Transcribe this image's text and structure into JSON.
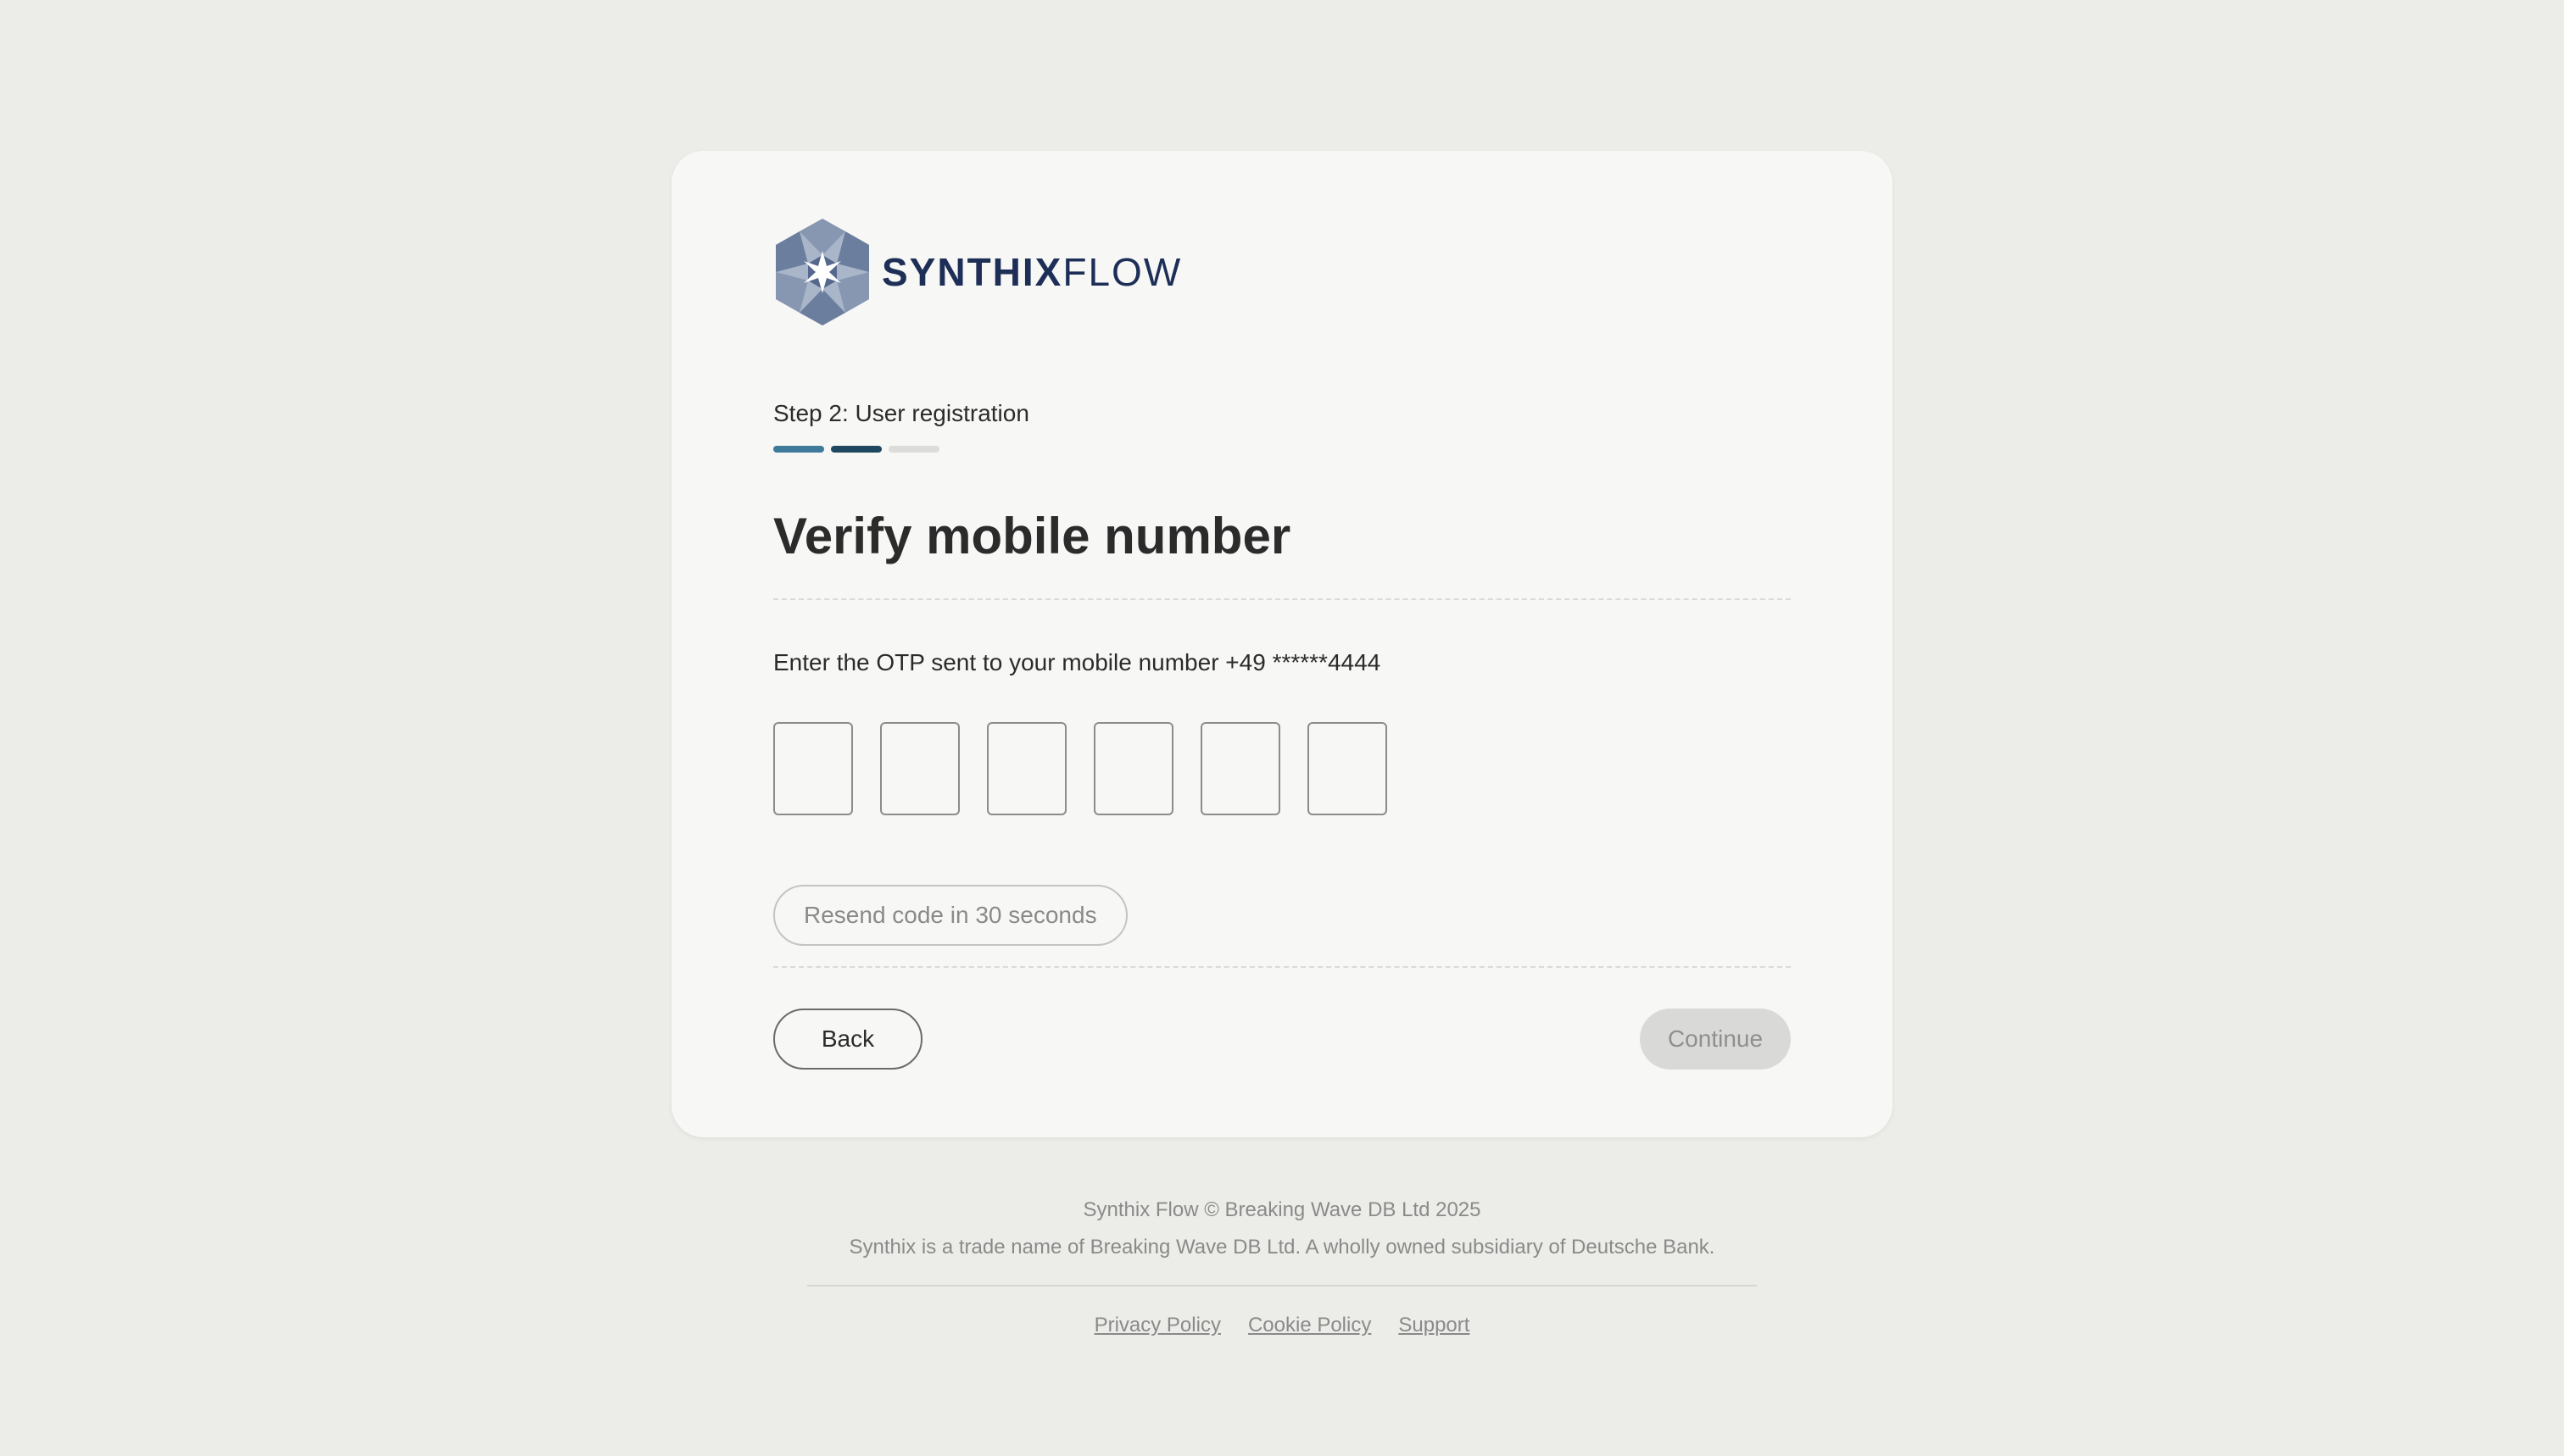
{
  "brand": {
    "name_bold": "SYNTHIX",
    "name_light": "FLOW",
    "color": "#1d2f57"
  },
  "step": {
    "label": "Step 2: User registration",
    "current": 2,
    "total": 3,
    "segment_colors": [
      "#3f7a9b",
      "#1f4860",
      "#dcdcda"
    ]
  },
  "page": {
    "title": "Verify mobile number",
    "otp_prompt": "Enter the OTP sent to your mobile number +49 ******4444"
  },
  "otp": {
    "digits": [
      "",
      "",
      "",
      "",
      "",
      ""
    ]
  },
  "actions": {
    "resend_label": "Resend code in 30 seconds",
    "back_label": "Back",
    "continue_label": "Continue"
  },
  "footer": {
    "copyright": "Synthix Flow © Breaking Wave DB Ltd 2025",
    "disclaimer": "Synthix is a trade name of Breaking Wave DB Ltd. A wholly owned subsidiary of Deutsche Bank.",
    "links": [
      "Privacy Policy",
      "Cookie Policy",
      "Support"
    ]
  }
}
